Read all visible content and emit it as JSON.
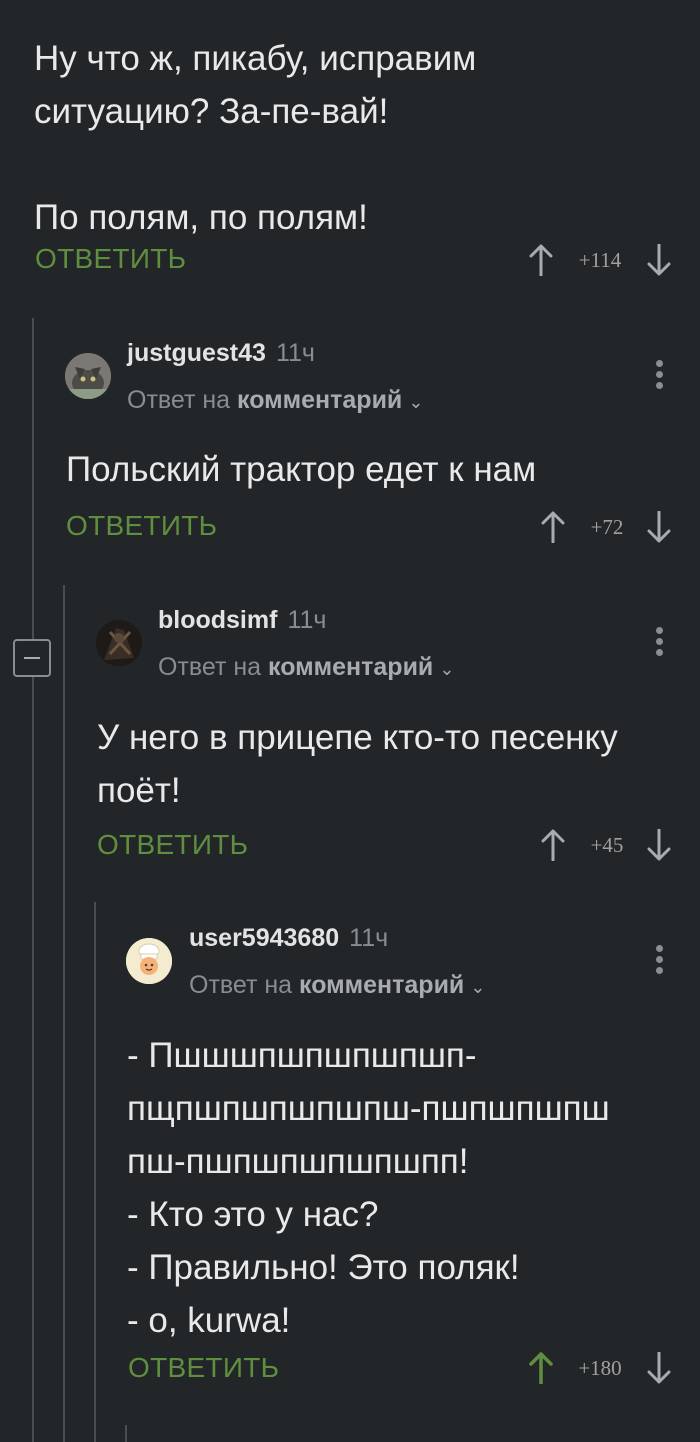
{
  "colors": {
    "background": "#232629",
    "accent_green": "#5f8f3e",
    "upvoted": "#5f8f3e",
    "muted_text": "#8a8d90",
    "thread_line": "#4a4d50"
  },
  "top_comment": {
    "text": "Ну что ж, пикабу, исправим\nситуацию? За-пе-вай!\n\nПо полям, по полям!",
    "reply_label": "ОТВЕТИТЬ",
    "rating": "+114",
    "upvoted": false
  },
  "comments": [
    {
      "author": "justguest43",
      "time": "11ч",
      "reply_to_prefix": "Ответ на",
      "reply_to_target": "комментарий",
      "avatar_icon": "cat-avatar-icon",
      "text": "Польский трактор едет к нам",
      "reply_label": "ОТВЕТИТЬ",
      "rating": "+72",
      "upvoted": false
    },
    {
      "author": "bloodsimf",
      "time": "11ч",
      "reply_to_prefix": "Ответ на",
      "reply_to_target": "комментарий",
      "avatar_icon": "dark-figure-avatar-icon",
      "text": "У него в прицепе кто-то песенку\nпоёт!",
      "reply_label": "ОТВЕТИТЬ",
      "rating": "+45",
      "upvoted": false
    },
    {
      "author": "user5943680",
      "time": "11ч",
      "reply_to_prefix": "Ответ на",
      "reply_to_target": "комментарий",
      "avatar_icon": "chef-avatar-icon",
      "text": "- Пшшшпшпшпшпшп-\nпщпшпшпшпшпш-пшпшпшпш\nпш-пшпшпшпшпшпп!\n- Кто это у нас?\n- Правильно! Это поляк!\n- о, kurwa!",
      "reply_label": "ОТВЕТИТЬ",
      "rating": "+180",
      "upvoted": true
    }
  ]
}
